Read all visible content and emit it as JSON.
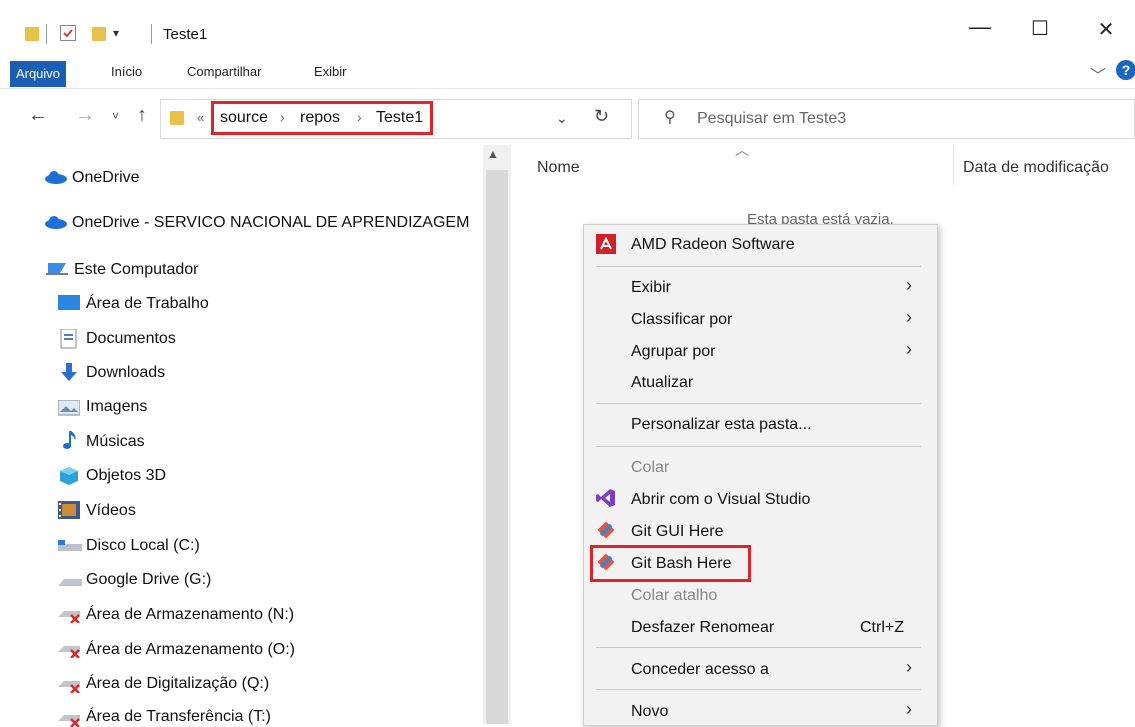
{
  "window": {
    "title": "Teste1",
    "controls": {
      "minimize": "—",
      "maximize": "☐",
      "close": "✕"
    }
  },
  "ribbon": {
    "tabs": [
      "Arquivo",
      "Início",
      "Compartilhar",
      "Exibir"
    ],
    "help": "?"
  },
  "address": {
    "overflow": "«",
    "crumbs": [
      "source",
      "repos",
      "Teste1"
    ],
    "separator": "›",
    "search_placeholder": "Pesquisar em Teste3"
  },
  "nav": {
    "items": [
      {
        "label": "OneDrive",
        "icon": "cloud-icon"
      },
      {
        "label": "OneDrive - SERVICO NACIONAL DE APRENDIZAGEM",
        "icon": "cloud-icon"
      },
      {
        "label": "Este Computador",
        "icon": "computer-icon"
      },
      {
        "label": "Área de Trabalho",
        "icon": "desktop-icon"
      },
      {
        "label": "Documentos",
        "icon": "documents-icon"
      },
      {
        "label": "Downloads",
        "icon": "download-icon"
      },
      {
        "label": "Imagens",
        "icon": "pictures-icon"
      },
      {
        "label": "Músicas",
        "icon": "music-icon"
      },
      {
        "label": "Objetos 3D",
        "icon": "objects-3d-icon"
      },
      {
        "label": "Vídeos",
        "icon": "videos-icon"
      },
      {
        "label": "Disco Local (C:)",
        "icon": "local-disk-icon"
      },
      {
        "label": "Google Drive (G:)",
        "icon": "drive-icon"
      },
      {
        "label": "Área de Armazenamento (N:)",
        "icon": "disconnected-drive-icon"
      },
      {
        "label": "Área de Armazenamento (O:)",
        "icon": "disconnected-drive-icon"
      },
      {
        "label": "Área de Digitalização (Q:)",
        "icon": "disconnected-drive-icon"
      },
      {
        "label": "Área de Transferência (T:)",
        "icon": "disconnected-drive-icon"
      }
    ]
  },
  "content": {
    "columns": [
      "Nome",
      "Data de modificação"
    ],
    "empty_message": "Esta pasta está vazia."
  },
  "context_menu": {
    "items": [
      {
        "label": "AMD Radeon Software",
        "icon": "amd-icon"
      },
      {
        "label": "Exibir",
        "submenu": true
      },
      {
        "label": "Classificar por",
        "submenu": true
      },
      {
        "label": "Agrupar por",
        "submenu": true
      },
      {
        "label": "Atualizar"
      },
      {
        "label": "Personalizar esta pasta..."
      },
      {
        "label": "Colar",
        "disabled": true
      },
      {
        "label": "Abrir com o Visual Studio",
        "icon": "visual-studio-icon"
      },
      {
        "label": "Git GUI Here",
        "icon": "git-icon"
      },
      {
        "label": "Git Bash Here",
        "icon": "git-icon"
      },
      {
        "label": "Colar atalho",
        "disabled": true
      },
      {
        "label": "Desfazer Renomear",
        "shortcut": "Ctrl+Z"
      },
      {
        "label": "Conceder acesso a",
        "submenu": true
      },
      {
        "label": "Novo",
        "submenu": true
      }
    ]
  },
  "colors": {
    "highlight": "#e0242a",
    "accent": "#1a5fb4",
    "folder": "#e9c04a"
  }
}
